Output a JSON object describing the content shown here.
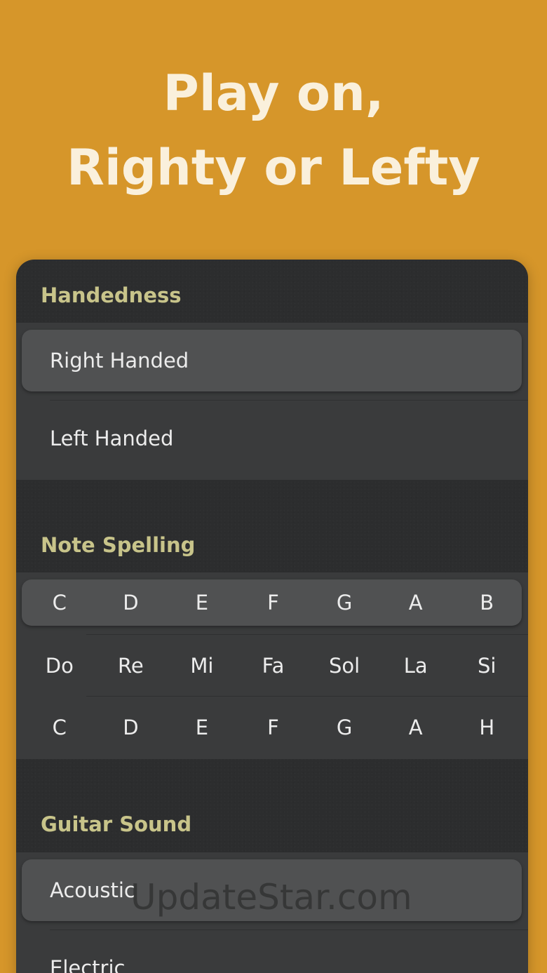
{
  "hero": {
    "line1": "Play on,",
    "line2": "Righty or Lefty"
  },
  "handedness": {
    "title": "Handedness",
    "options": [
      "Right Handed",
      "Left Handed"
    ],
    "selected": "Right Handed"
  },
  "note_spelling": {
    "title": "Note Spelling",
    "rows": [
      [
        "C",
        "D",
        "E",
        "F",
        "G",
        "A",
        "B"
      ],
      [
        "Do",
        "Re",
        "Mi",
        "Fa",
        "Sol",
        "La",
        "Si"
      ],
      [
        "C",
        "D",
        "E",
        "F",
        "G",
        "A",
        "H"
      ]
    ],
    "selected_row": 0
  },
  "guitar_sound": {
    "title": "Guitar Sound",
    "options": [
      "Acoustic",
      "Electric"
    ],
    "selected": "Acoustic"
  },
  "watermark": "UpdateStar.com",
  "colors": {
    "background": "#d6962a",
    "panel": "#2c2d2e",
    "section_title": "#c8c48a",
    "selected_row": "#505152"
  }
}
